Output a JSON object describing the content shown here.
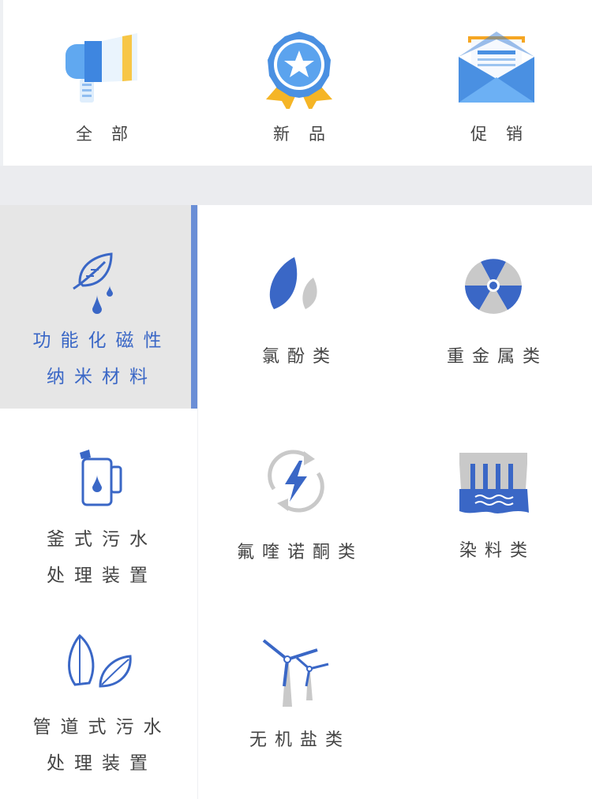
{
  "top_tabs": [
    {
      "label": "全部",
      "icon": "megaphone-icon"
    },
    {
      "label": "新品",
      "icon": "badge-star-icon"
    },
    {
      "label": "促销",
      "icon": "envelope-icon"
    }
  ],
  "sidebar": {
    "items": [
      {
        "line1": "功能化磁性",
        "line2": "纳米材料",
        "icon": "leaf-droplet-icon",
        "active": true
      },
      {
        "line1": "釜式污水",
        "line2": "处理装置",
        "icon": "kettle-icon",
        "active": false
      },
      {
        "line1": "管道式污水",
        "line2": "处理装置",
        "icon": "leaves-icon",
        "active": false
      }
    ]
  },
  "categories": [
    {
      "label": "氯酚类",
      "icon": "leaf-pair-icon"
    },
    {
      "label": "重金属类",
      "icon": "radiation-icon"
    },
    {
      "label": "氟喹诺酮类",
      "icon": "energy-cycle-icon"
    },
    {
      "label": "染料类",
      "icon": "factory-water-icon"
    },
    {
      "label": "无机盐类",
      "icon": "wind-turbine-icon"
    }
  ],
  "colors": {
    "accent": "#3a67c6",
    "active_bg": "#e6e6e6",
    "gap_bg": "#ebecef"
  }
}
